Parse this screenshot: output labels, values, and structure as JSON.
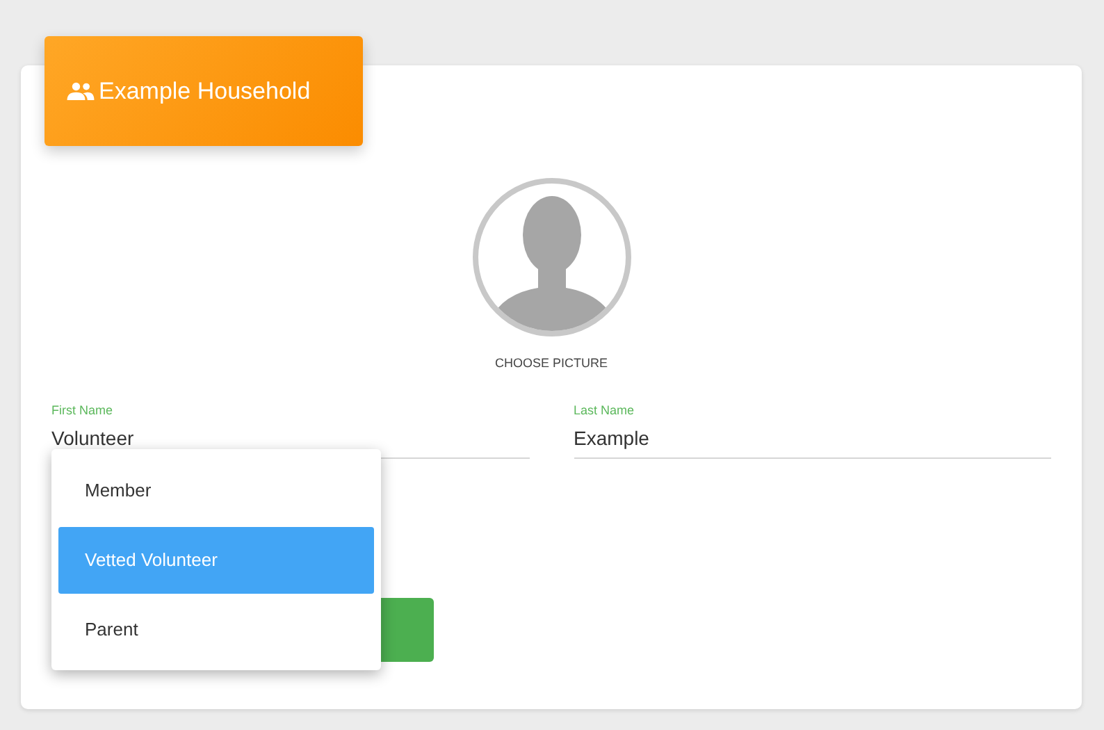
{
  "header": {
    "title": "Example Household"
  },
  "avatar": {
    "action": "CHOOSE PICTURE"
  },
  "fields": [
    {
      "label": "First Name",
      "value": "Volunteer"
    },
    {
      "label": "Last Name",
      "value": "Example"
    }
  ],
  "menu": {
    "items": [
      {
        "label": "Member",
        "selected": false
      },
      {
        "label": "Vetted Volunteer",
        "selected": true
      },
      {
        "label": "Parent",
        "selected": false
      }
    ]
  }
}
